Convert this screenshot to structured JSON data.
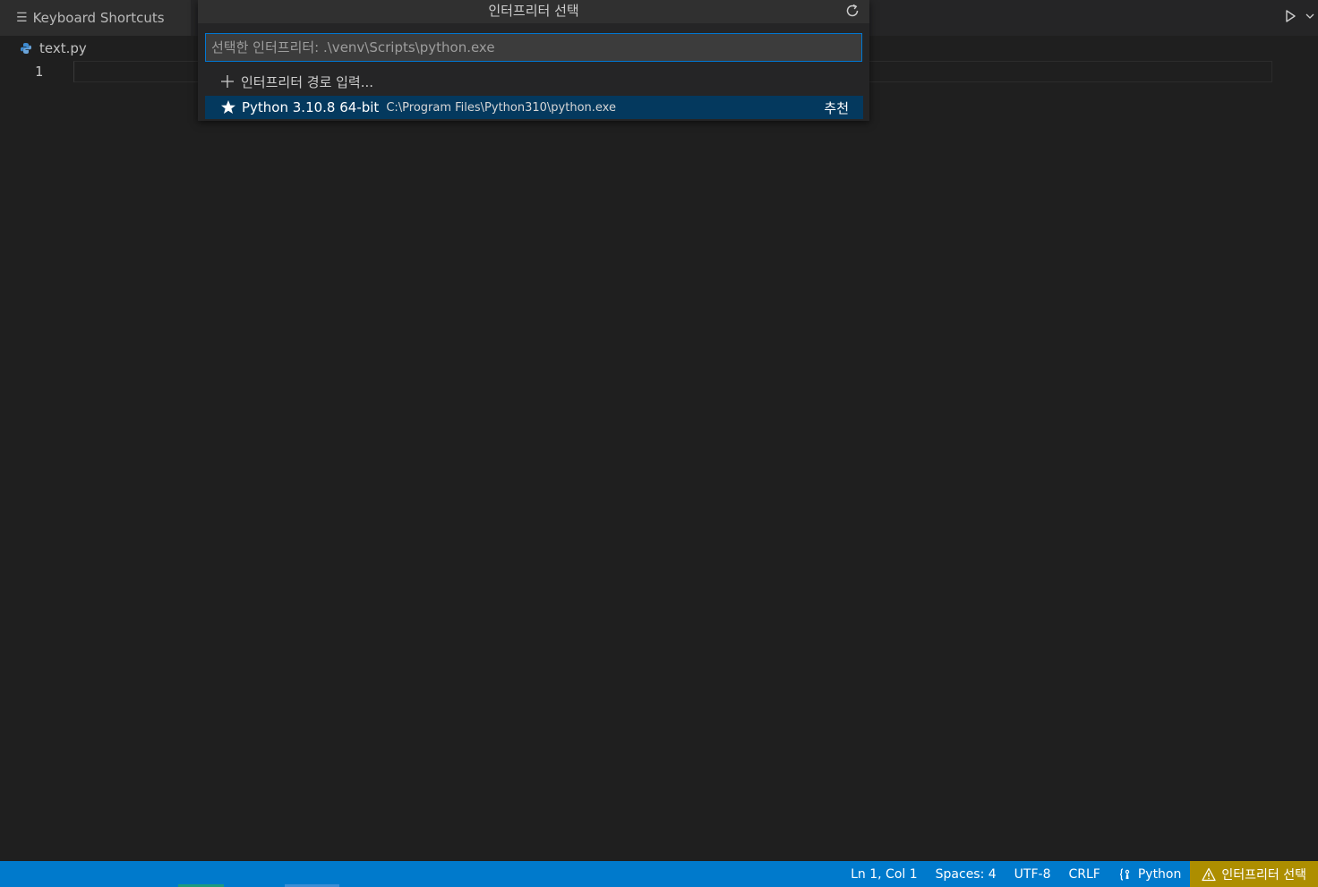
{
  "tabs": [
    {
      "label": "Keyboard Shortcuts",
      "icon": "list-icon"
    }
  ],
  "breadcrumb": {
    "file": "text.py",
    "icon": "python-file-icon"
  },
  "editor": {
    "line_numbers": [
      "1"
    ]
  },
  "quick_pick": {
    "title": "인터프리터 선택",
    "input_placeholder": "선택한 인터프리터: .\\venv\\Scripts\\python.exe",
    "items": [
      {
        "icon": "plus-icon",
        "label": "인터프리터 경로 입력..."
      },
      {
        "icon": "star-icon",
        "label": "Python 3.10.8 64-bit",
        "description": "C:\\Program Files\\Python310\\python.exe",
        "badge": "추천"
      }
    ]
  },
  "statusbar": {
    "position": "Ln 1, Col 1",
    "spaces": "Spaces: 4",
    "encoding": "UTF-8",
    "eol": "CRLF",
    "language": "Python",
    "interpreter_warning": "인터프리터 선택"
  },
  "colors": {
    "statusbar_bg": "#007acc",
    "warning_bg": "#ad8e00",
    "selection_bg": "#04395e",
    "focus_border": "#0078d4",
    "editor_bg": "#1f1f1f"
  }
}
